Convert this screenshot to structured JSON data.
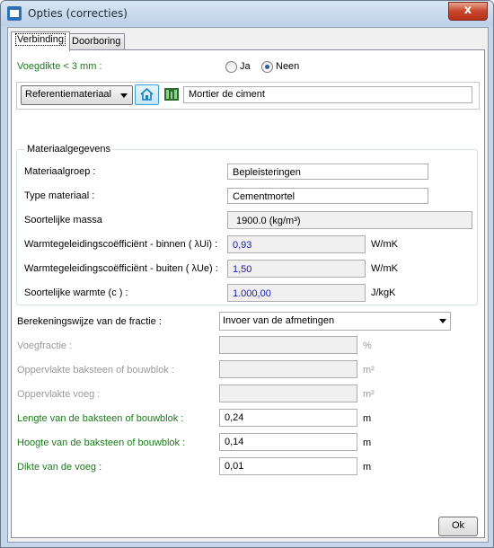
{
  "window": {
    "title": "Opties (correcties)",
    "close_glyph": "x"
  },
  "tabs": [
    {
      "label": "Verbinding"
    },
    {
      "label": "Doorboring"
    }
  ],
  "voegdikte": {
    "label": "Voegdikte < 3 mm :",
    "option_yes": "Ja",
    "option_no": "Neen",
    "selected": "Neen"
  },
  "material_bar": {
    "dropdown_label": "Referentiemateriaal",
    "material_name": "Mortier de ciment"
  },
  "group": {
    "title": "Materiaalgegevens",
    "rows": [
      {
        "label": "Materiaalgroep :",
        "value": "Bepleisteringen",
        "unit": ""
      },
      {
        "label": "Type materiaal :",
        "value": "Cementmortel",
        "unit": ""
      },
      {
        "label": "Soortelijke massa",
        "value": "1900.0 (kg/m³)",
        "unit": ""
      },
      {
        "label": "Warmtegeleidingscoëfficiënt - binnen ( λUi) :",
        "value": "0,93",
        "unit": "W/mK"
      },
      {
        "label": "Warmtegeleidingscoëfficiënt - buiten ( λUe) :",
        "value": "1,50",
        "unit": "W/mK"
      },
      {
        "label": "Soortelijke warmte (c ) :",
        "value": "1.000,00",
        "unit": "J/kgK"
      }
    ]
  },
  "fraction": {
    "label": "Berekeningswijze van de fractie :",
    "selected": "Invoer van de afmetingen",
    "rows": [
      {
        "label": "Voegfractie :",
        "value": "",
        "unit": "%"
      },
      {
        "label": "Oppervlakte baksteen of bouwblok :",
        "value": "",
        "unit": "m²"
      },
      {
        "label": "Oppervlakte voeg :",
        "value": "",
        "unit": "m²"
      },
      {
        "label": "Lengte van de baksteen of bouwblok :",
        "value": "0,24",
        "unit": "m"
      },
      {
        "label": "Hoogte van de baksteen of bouwblok :",
        "value": "0,14",
        "unit": "m"
      },
      {
        "label": "Dikte van de voeg :",
        "value": "0,01",
        "unit": "m"
      }
    ]
  },
  "footer": {
    "ok_label": "Ok"
  },
  "colors": {
    "title_bar": "#c9d9ee",
    "close_button": "#c7462b",
    "label_green": "#1a7a1a",
    "value_blue": "#1a1aa8",
    "label_disabled": "#9a9a9a"
  },
  "icons": {
    "app": "window-app-icon",
    "house": "house-icon",
    "material": "material-swatch-icon"
  }
}
